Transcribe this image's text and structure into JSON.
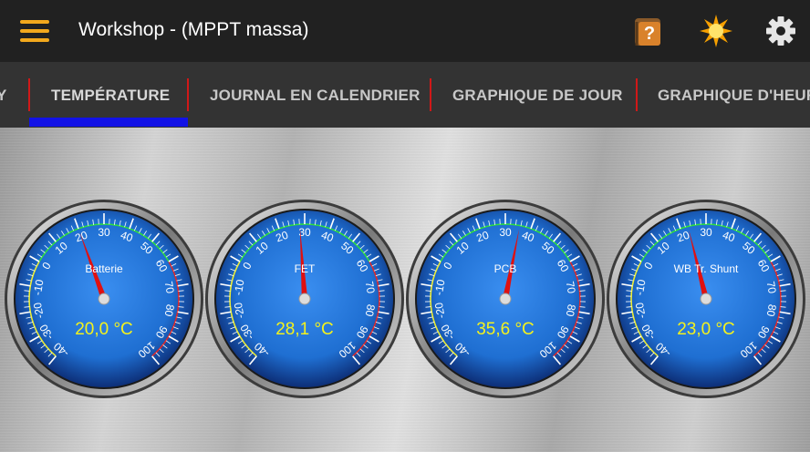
{
  "appbar": {
    "title": "Workshop - (MPPT massa)",
    "menu_icon": "hamburger-menu-icon",
    "help_icon": "help-book-icon",
    "brightness_icon": "sun-icon",
    "settings_icon": "gear-icon",
    "colors": {
      "background": "#212121",
      "menu": "#f2a81d"
    }
  },
  "tabs": [
    {
      "label": "Y"
    },
    {
      "label": "TEMPÉRATURE",
      "active": true
    },
    {
      "label": "JOURNAL EN CALENDRIER"
    },
    {
      "label": "GRAPHIQUE DE JOUR"
    },
    {
      "label": "GRAPHIQUE D'HEURE"
    }
  ],
  "gauge_scale": {
    "ticks": [
      "-40",
      "-30",
      "-20",
      "-10",
      "0",
      "10",
      "20",
      "30",
      "40",
      "50",
      "60",
      "70",
      "80",
      "90",
      "100"
    ],
    "min": -40,
    "max": 100,
    "cold_zone_end": 0,
    "normal_zone_end": 60,
    "colors": {
      "cold": "#ecec30",
      "normal": "#2fe03a",
      "hot": "#e02828",
      "face": "#1f6fd2",
      "value_text": "#f4f21c"
    }
  },
  "gauges": [
    {
      "label": "Batterie",
      "value": 20.0,
      "display": "20,0 °C"
    },
    {
      "label": "FET",
      "value": 28.1,
      "display": "28,1 °C"
    },
    {
      "label": "PCB",
      "value": 35.6,
      "display": "35,6 °C"
    },
    {
      "label": "WB Tr. Shunt",
      "value": 23.0,
      "display": "23,0 °C"
    }
  ]
}
